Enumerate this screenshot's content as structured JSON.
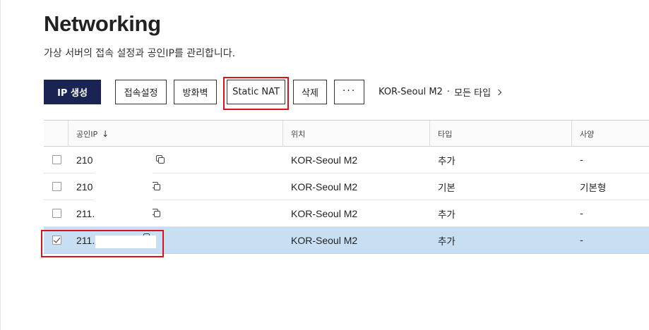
{
  "page": {
    "title": "Networking",
    "subtitle": "가상 서버의 접속 설정과 공인IP를 관리합니다."
  },
  "toolbar": {
    "create_ip": "IP 생성",
    "access_settings": "접속설정",
    "firewall": "방화벽",
    "static_nat": "Static NAT",
    "delete": "삭제",
    "more": "···",
    "region": "KOR-Seoul M2",
    "separator": "·",
    "type_filter": "모든 타입"
  },
  "table": {
    "columns": {
      "public_ip": "공인IP",
      "sort_indicator": "↓",
      "location": "위치",
      "type": "타입",
      "spec": "사양"
    },
    "rows": [
      {
        "ip": "210",
        "location": "KOR-Seoul M2",
        "type": "추가",
        "spec": "-",
        "checked": false
      },
      {
        "ip": "210",
        "location": "KOR-Seoul M2",
        "type": "기본",
        "spec": "기본형",
        "checked": false
      },
      {
        "ip": "211.",
        "location": "KOR-Seoul M2",
        "type": "추가",
        "spec": "-",
        "checked": false
      },
      {
        "ip": "211.",
        "location": "KOR-Seoul M2",
        "type": "추가",
        "spec": "-",
        "checked": true
      }
    ]
  },
  "colors": {
    "primary": "#1a2452",
    "selected_row": "#c8dff3",
    "highlight": "#d8141b"
  }
}
